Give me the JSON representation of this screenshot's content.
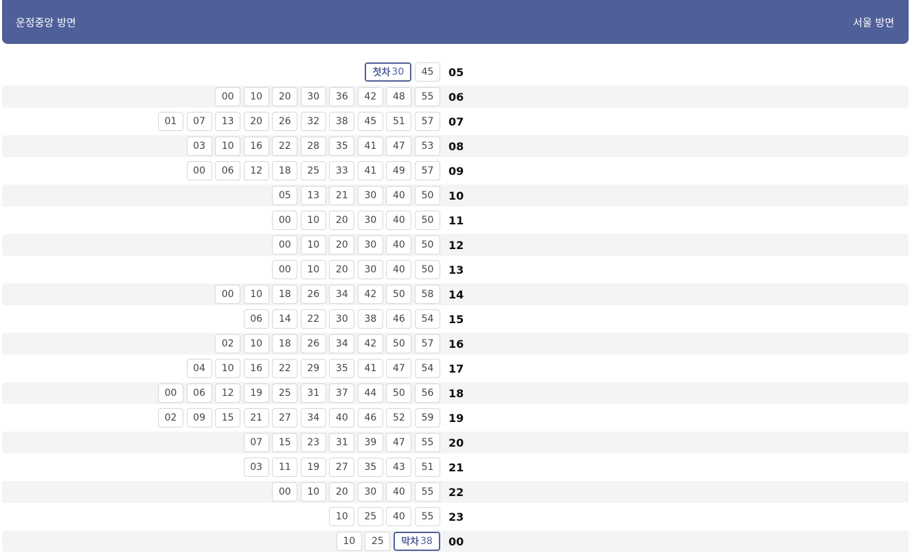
{
  "header": {
    "left_direction": "운정중앙 방면",
    "right_direction": "서울 방면"
  },
  "colors": {
    "accent": "#4f5f99",
    "row_shade": "#f4f4f4"
  },
  "rows": [
    {
      "hour": "05",
      "minutes": [
        "30",
        "45"
      ],
      "first_label": "첫차"
    },
    {
      "hour": "06",
      "minutes": [
        "00",
        "10",
        "20",
        "30",
        "36",
        "42",
        "48",
        "55"
      ]
    },
    {
      "hour": "07",
      "minutes": [
        "01",
        "07",
        "13",
        "20",
        "26",
        "32",
        "38",
        "45",
        "51",
        "57"
      ]
    },
    {
      "hour": "08",
      "minutes": [
        "03",
        "10",
        "16",
        "22",
        "28",
        "35",
        "41",
        "47",
        "53"
      ]
    },
    {
      "hour": "09",
      "minutes": [
        "00",
        "06",
        "12",
        "18",
        "25",
        "33",
        "41",
        "49",
        "57"
      ]
    },
    {
      "hour": "10",
      "minutes": [
        "05",
        "13",
        "21",
        "30",
        "40",
        "50"
      ]
    },
    {
      "hour": "11",
      "minutes": [
        "00",
        "10",
        "20",
        "30",
        "40",
        "50"
      ]
    },
    {
      "hour": "12",
      "minutes": [
        "00",
        "10",
        "20",
        "30",
        "40",
        "50"
      ]
    },
    {
      "hour": "13",
      "minutes": [
        "00",
        "10",
        "20",
        "30",
        "40",
        "50"
      ]
    },
    {
      "hour": "14",
      "minutes": [
        "00",
        "10",
        "18",
        "26",
        "34",
        "42",
        "50",
        "58"
      ]
    },
    {
      "hour": "15",
      "minutes": [
        "06",
        "14",
        "22",
        "30",
        "38",
        "46",
        "54"
      ]
    },
    {
      "hour": "16",
      "minutes": [
        "02",
        "10",
        "18",
        "26",
        "34",
        "42",
        "50",
        "57"
      ]
    },
    {
      "hour": "17",
      "minutes": [
        "04",
        "10",
        "16",
        "22",
        "29",
        "35",
        "41",
        "47",
        "54"
      ]
    },
    {
      "hour": "18",
      "minutes": [
        "00",
        "06",
        "12",
        "19",
        "25",
        "31",
        "37",
        "44",
        "50",
        "56"
      ]
    },
    {
      "hour": "19",
      "minutes": [
        "02",
        "09",
        "15",
        "21",
        "27",
        "34",
        "40",
        "46",
        "52",
        "59"
      ]
    },
    {
      "hour": "20",
      "minutes": [
        "07",
        "15",
        "23",
        "31",
        "39",
        "47",
        "55"
      ]
    },
    {
      "hour": "21",
      "minutes": [
        "03",
        "11",
        "19",
        "27",
        "35",
        "43",
        "51"
      ]
    },
    {
      "hour": "22",
      "minutes": [
        "00",
        "10",
        "20",
        "30",
        "40",
        "55"
      ]
    },
    {
      "hour": "23",
      "minutes": [
        "10",
        "25",
        "40",
        "55"
      ]
    },
    {
      "hour": "00",
      "minutes": [
        "10",
        "25",
        "38"
      ],
      "last_label": "막차"
    }
  ]
}
